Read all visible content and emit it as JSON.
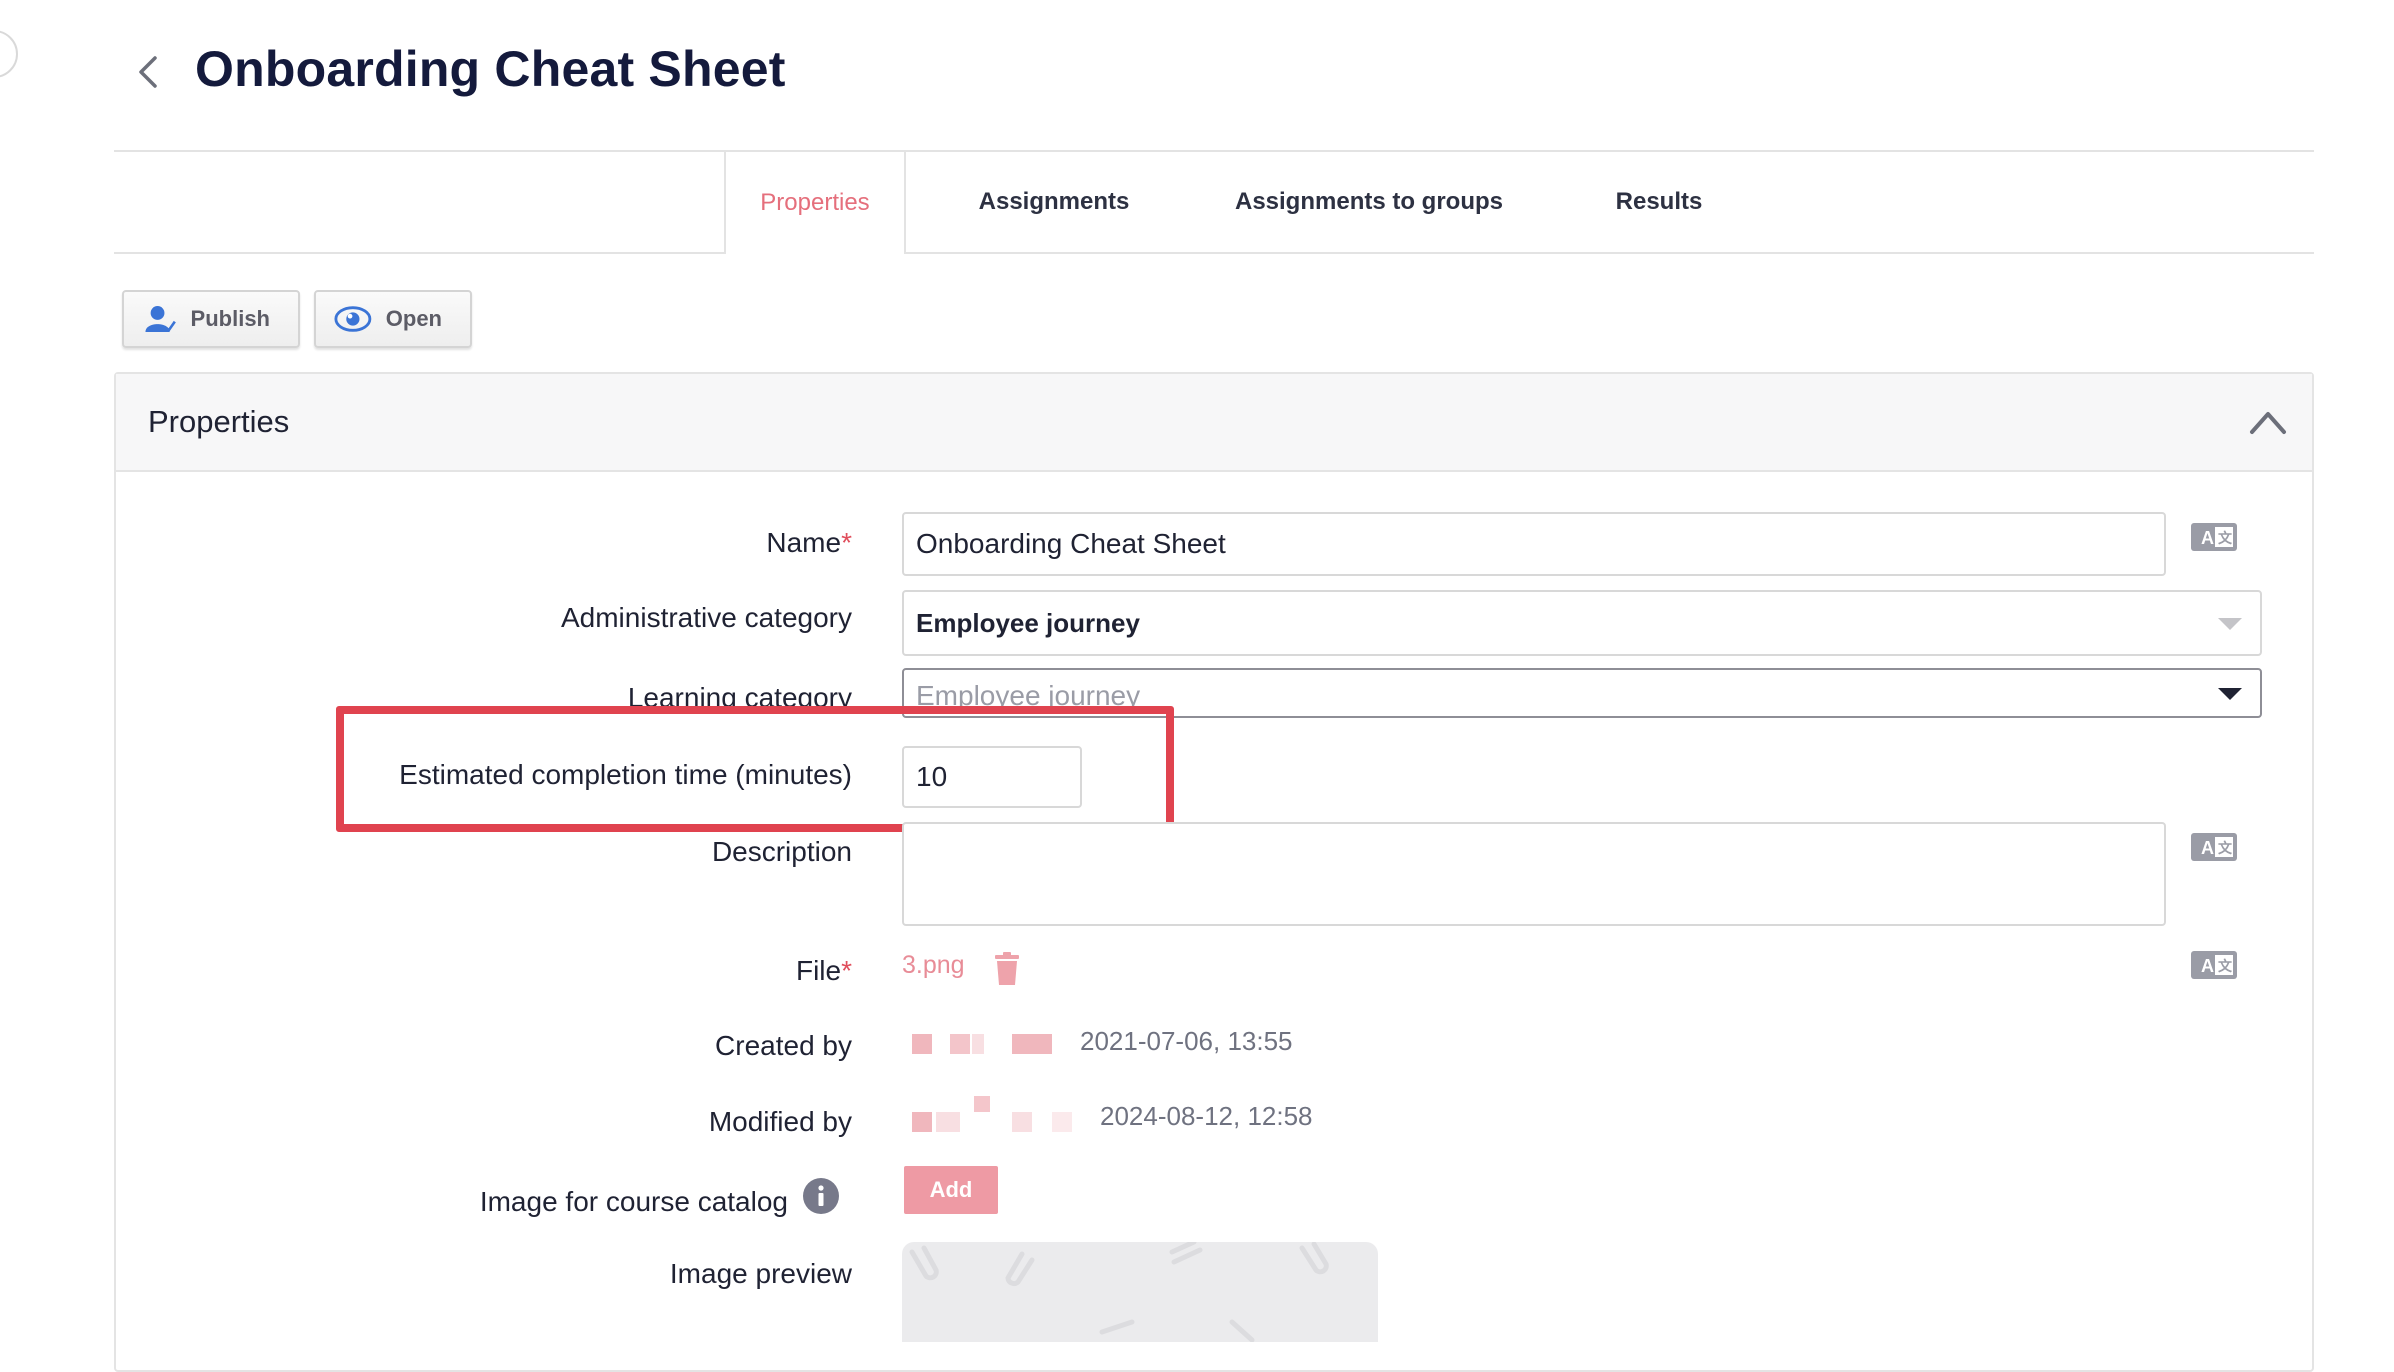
{
  "header": {
    "title": "Onboarding Cheat Sheet",
    "back_icon": "chevron-left-icon"
  },
  "tabs": [
    {
      "label": "Properties",
      "active": true
    },
    {
      "label": "Assignments",
      "active": false
    },
    {
      "label": "Assignments to groups",
      "active": false
    },
    {
      "label": "Results",
      "active": false
    }
  ],
  "toolbar": {
    "publish_label": "Publish",
    "open_label": "Open"
  },
  "panel": {
    "title": "Properties"
  },
  "form": {
    "name_label": "Name",
    "name_value": "Onboarding Cheat Sheet",
    "admin_category_label": "Administrative category",
    "admin_category_value": "Employee journey",
    "learning_category_label": "Learning category",
    "learning_category_value": "Employee journey",
    "est_time_label": "Estimated completion time (minutes)",
    "est_time_value": "10",
    "description_label": "Description",
    "description_value": "",
    "file_label": "File",
    "file_name": "3.png",
    "created_by_label": "Created by",
    "created_by_date": "2021-07-06, 13:55",
    "modified_by_label": "Modified by",
    "modified_by_date": "2024-08-12, 12:58",
    "image_catalog_label": "Image for course catalog",
    "add_button": "Add",
    "image_preview_label": "Image preview",
    "required_mark": "*"
  },
  "colors": {
    "accent": "#e56f7c",
    "title": "#141a3c",
    "highlight": "#e0434f",
    "icon_blue": "#3b74d6"
  }
}
